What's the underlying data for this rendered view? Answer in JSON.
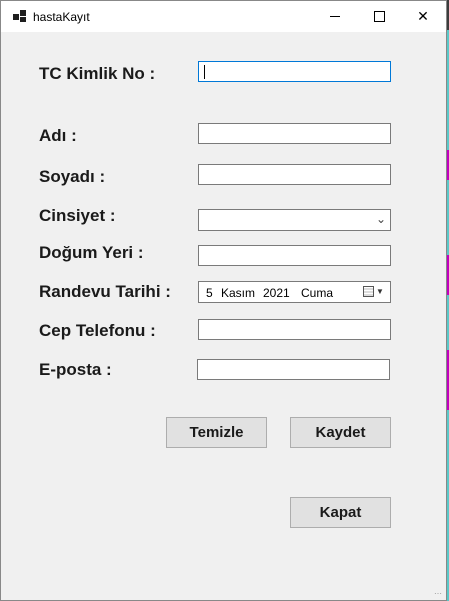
{
  "window": {
    "title": "hastaKayıt",
    "controls": {
      "minimize": "minimize",
      "maximize": "maximize",
      "close": "✕"
    }
  },
  "form": {
    "tc_label": "TC Kimlik No :",
    "tc_value": "",
    "ad_label": "Adı :",
    "ad_value": "",
    "soyad_label": "Soyadı :",
    "soyad_value": "",
    "cinsiyet_label": "Cinsiyet :",
    "cinsiyet_value": "",
    "dogum_label": "Doğum Yeri :",
    "dogum_value": "",
    "randevu_label": "Randevu Tarihi :",
    "randevu_day": "5",
    "randevu_month": "Kasım",
    "randevu_year": "2021",
    "randevu_weekday": "Cuma",
    "cep_label": "Cep Telefonu :",
    "cep_value": "",
    "eposta_label": "E-posta :",
    "eposta_value": ""
  },
  "buttons": {
    "temizle": "Temizle",
    "kaydet": "Kaydet",
    "kapat": "Kapat"
  },
  "colors": {
    "background_strip_cyan": "#5bc8c8",
    "background_strip_magenta": "#c000c0",
    "focus_border": "#0078d7"
  }
}
